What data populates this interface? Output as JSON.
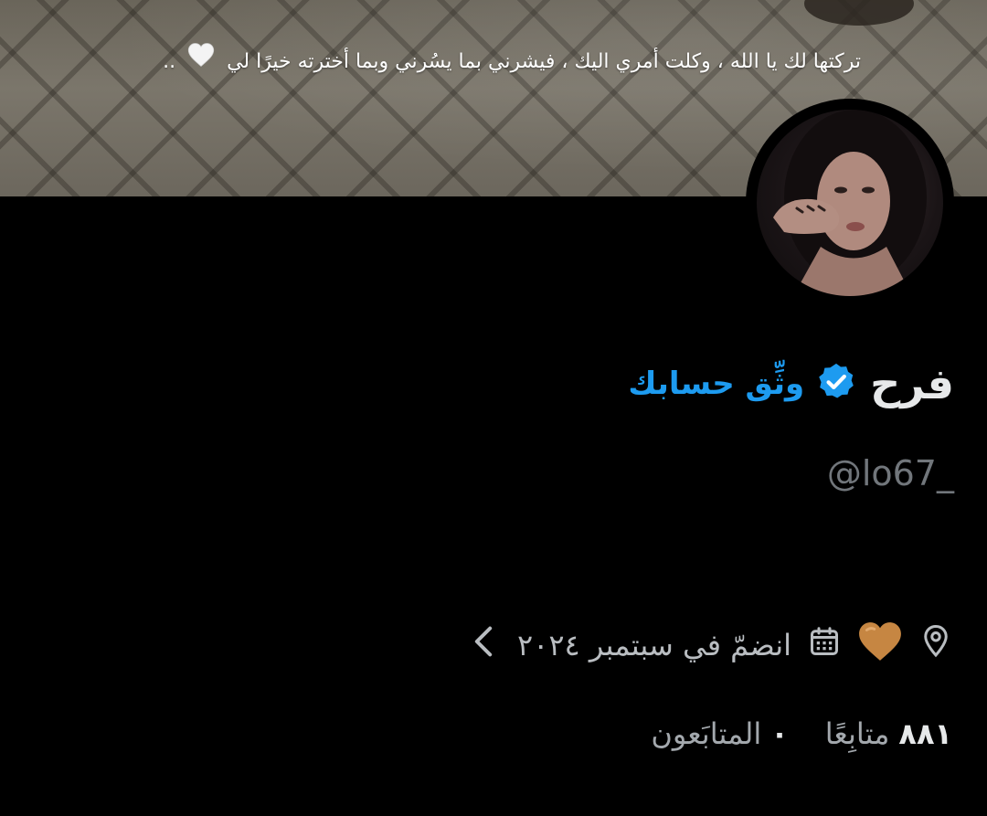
{
  "banner": {
    "caption": "تركتها لك يا الله ، وكلت أمري اليك ، فيشرني بما يسُرني وبما أخترته خيرًا لي",
    "caption_end": "..",
    "heart_icon": "white-heart-emoji"
  },
  "profile": {
    "name": "فرح",
    "verify_label": "وثِّق حسابك",
    "handle": "@lo67_",
    "verified_badge_color": "#1d9bf0"
  },
  "meta": {
    "location_icon": "location-pin-icon",
    "bio_emoji": "brown-heart-emoji",
    "calendar_icon": "calendar-icon",
    "joined": "انضمّ في سبتمبر ٢٠٢٤",
    "more_icon": "chevron-left-icon"
  },
  "stats": {
    "following_count": "٨٨١",
    "following_label": "متابِعًا",
    "followers_count": "٠",
    "followers_label": "المتابَعون"
  },
  "colors": {
    "background": "#000000",
    "accent": "#1d9bf0",
    "muted": "#71767b",
    "heart_brown": "#c68642"
  }
}
